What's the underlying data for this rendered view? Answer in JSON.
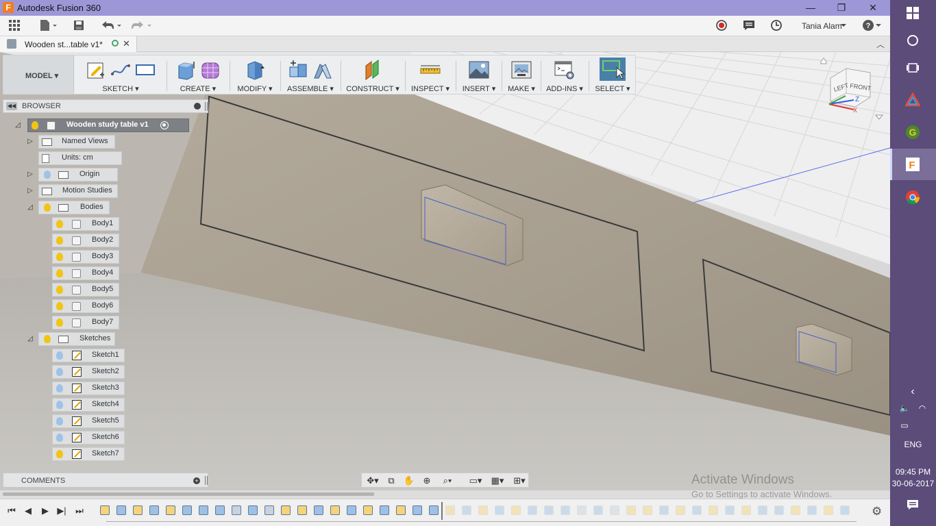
{
  "window": {
    "app_icon": "F",
    "title": "Autodesk Fusion 360",
    "minimize": "—",
    "maximize": "❐",
    "close": "✕"
  },
  "qat": {
    "user_name": "Tania Alam",
    "icons": [
      "grid-menu-icon",
      "file-icon",
      "save-icon",
      "undo-icon",
      "redo-icon",
      "record-icon",
      "comments-icon",
      "history-icon",
      "user-icon",
      "help-icon"
    ]
  },
  "doc_tab": {
    "label": "Wooden st...table v1*",
    "close": "✕"
  },
  "ribbon": {
    "workspace": "MODEL ▾",
    "groups": [
      {
        "label": "SKETCH ▾"
      },
      {
        "label": "CREATE ▾"
      },
      {
        "label": "MODIFY ▾"
      },
      {
        "label": "ASSEMBLE ▾"
      },
      {
        "label": "CONSTRUCT ▾"
      },
      {
        "label": "INSPECT ▾"
      },
      {
        "label": "INSERT ▾"
      },
      {
        "label": "MAKE ▾"
      },
      {
        "label": "ADD-INS ▾"
      },
      {
        "label": "SELECT ▾"
      }
    ]
  },
  "browser": {
    "title": "BROWSER",
    "root": "Wooden study table v1",
    "named_views": "Named Views",
    "units": "Units: cm",
    "origin": "Origin",
    "motion_studies": "Motion Studies",
    "bodies": "Bodies",
    "body_items": [
      "Body1",
      "Body2",
      "Body3",
      "Body4",
      "Body5",
      "Body6",
      "Body7"
    ],
    "sketches": "Sketches",
    "sketch_items": [
      "Sketch1",
      "Sketch2",
      "Sketch3",
      "Sketch4",
      "Sketch5",
      "Sketch6",
      "Sketch7"
    ]
  },
  "comments": {
    "title": "COMMENTS"
  },
  "viewcube": {
    "left": "LEFT",
    "front": "FRONT",
    "axis_z": "Z",
    "axis_x": "X"
  },
  "watermark": {
    "line1": "Activate Windows",
    "line2": "Go to Settings to activate Windows."
  },
  "taskbar": {
    "language": "ENG",
    "time": "09:45 PM",
    "date": "30-06-2017"
  },
  "colors": {
    "titlebar": "#9d97d8",
    "taskbar": "#5b4c7a",
    "accent_orange": "#f07f1e",
    "select_blue": "#4a7fa8",
    "bulb_yellow": "#f2c417",
    "bulb_blue": "#9fc3e6"
  }
}
